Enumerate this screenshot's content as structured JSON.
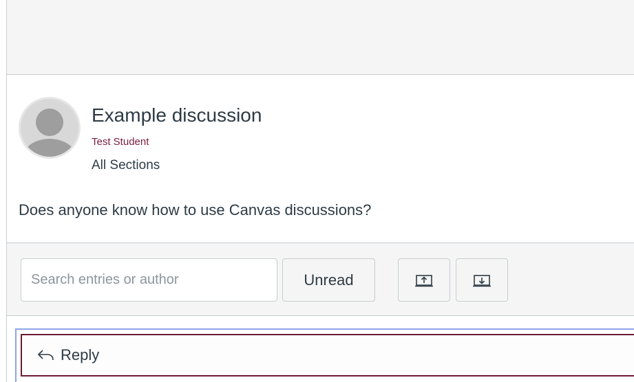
{
  "topic": {
    "title": "Example discussion",
    "author": "Test Student",
    "sections": "All Sections",
    "message": "Does anyone know how to use Canvas discussions?"
  },
  "toolbar": {
    "search_placeholder": "Search entries or author",
    "unread_label": "Unread",
    "collapse_icon": "collapse-all-icon",
    "expand_icon": "expand-all-icon"
  },
  "reply": {
    "label": "Reply",
    "icon": "reply-arrow-icon"
  },
  "colors": {
    "author": "#7b1c3c",
    "text": "#2d3b45",
    "reply_border": "#6e1a33",
    "focus_ring": "#8ea3e6"
  }
}
